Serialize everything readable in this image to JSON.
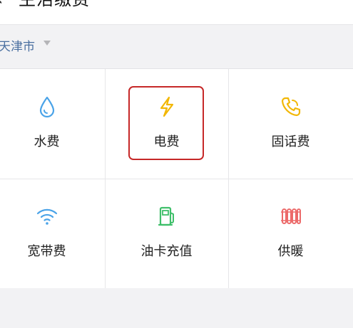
{
  "header": {
    "title": "生活缴费",
    "back_icon": "chevron-left-icon",
    "more_icon": "more-dots-icon"
  },
  "city": {
    "name": "天津市",
    "caret_icon": "caret-down-icon"
  },
  "services": [
    {
      "label": "水费",
      "icon": "water-drop-icon",
      "color": "#4aa3e8"
    },
    {
      "label": "电费",
      "icon": "lightning-icon",
      "color": "#f2b705"
    },
    {
      "label": "固话费",
      "icon": "phone-icon",
      "color": "#f2b705"
    },
    {
      "label": "宽带费",
      "icon": "wifi-icon",
      "color": "#4aa3e8"
    },
    {
      "label": "油卡充值",
      "icon": "fuel-pump-icon",
      "color": "#3fbf6a"
    },
    {
      "label": "供暖",
      "icon": "radiator-icon",
      "color": "#ec6a6a"
    }
  ],
  "highlight_color": "#c62828"
}
